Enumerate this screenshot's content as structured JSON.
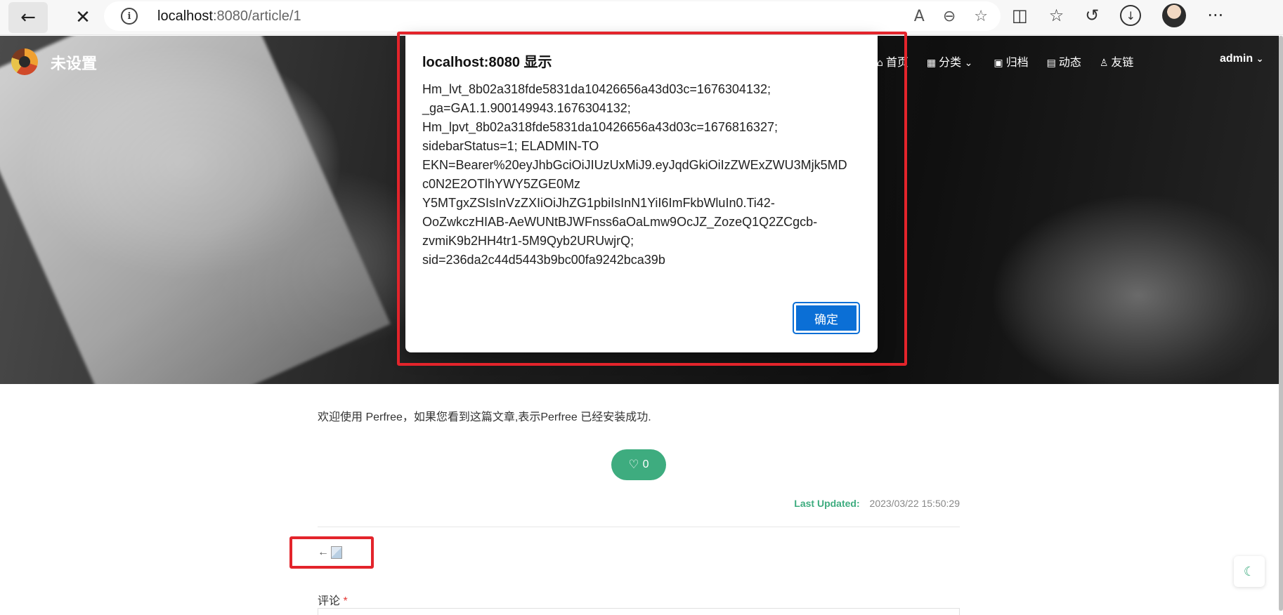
{
  "browser": {
    "url_host": "localhost",
    "url_path": ":8080/article/1"
  },
  "site": {
    "title": "未设置",
    "nav": [
      {
        "label": "首页",
        "icon": "home-icon"
      },
      {
        "label": "分类",
        "icon": "grid-icon",
        "dropdown": true
      },
      {
        "label": "归档",
        "icon": "calendar-icon"
      },
      {
        "label": "动态",
        "icon": "newspaper-icon"
      },
      {
        "label": "友链",
        "icon": "user-icon"
      }
    ],
    "user": "admin"
  },
  "article": {
    "body": "欢迎使用 Perfree，如果您看到这篇文章,表示Perfree 已经安装成功.",
    "likes": "0",
    "last_updated_label": "Last Updated:",
    "last_updated_value": "2023/03/22 15:50:29",
    "prev_arrow": "←",
    "comment_label": "评论",
    "comment_required": "*"
  },
  "dialog": {
    "title": "localhost:8080 显示",
    "message": "Hm_lvt_8b02a318fde5831da10426656a43d03c=1676304132;\n_ga=GA1.1.900149943.1676304132;\nHm_lpvt_8b02a318fde5831da10426656a43d03c=1676816327;\nsidebarStatus=1; ELADMIN-TO\nEKN=Bearer%20eyJhbGciOiJIUzUxMiJ9.eyJqdGkiOiIzZWExZWU3Mjk5MD\nc0N2E2OTlhYWY5ZGE0Mz\nY5MTgxZSIsInVzZXIiOiJhZG1pbiIsInN1YiI6ImFkbWluIn0.Ti42-\nOoZwkczHIAB-AeWUNtBJWFnss6aOaLmw9OcJZ_ZozeQ1Q2ZCgcb-\nzvmiK9b2HH4tr1-5M9Qyb2URUwjrQ;\nsid=236da2c44d5443b9bc00fa9242bca39b",
    "ok_label": "确定"
  },
  "colors": {
    "accent": "#3eac7f",
    "annotation": "#e3242b",
    "dialog_button": "#0b6fd6"
  }
}
